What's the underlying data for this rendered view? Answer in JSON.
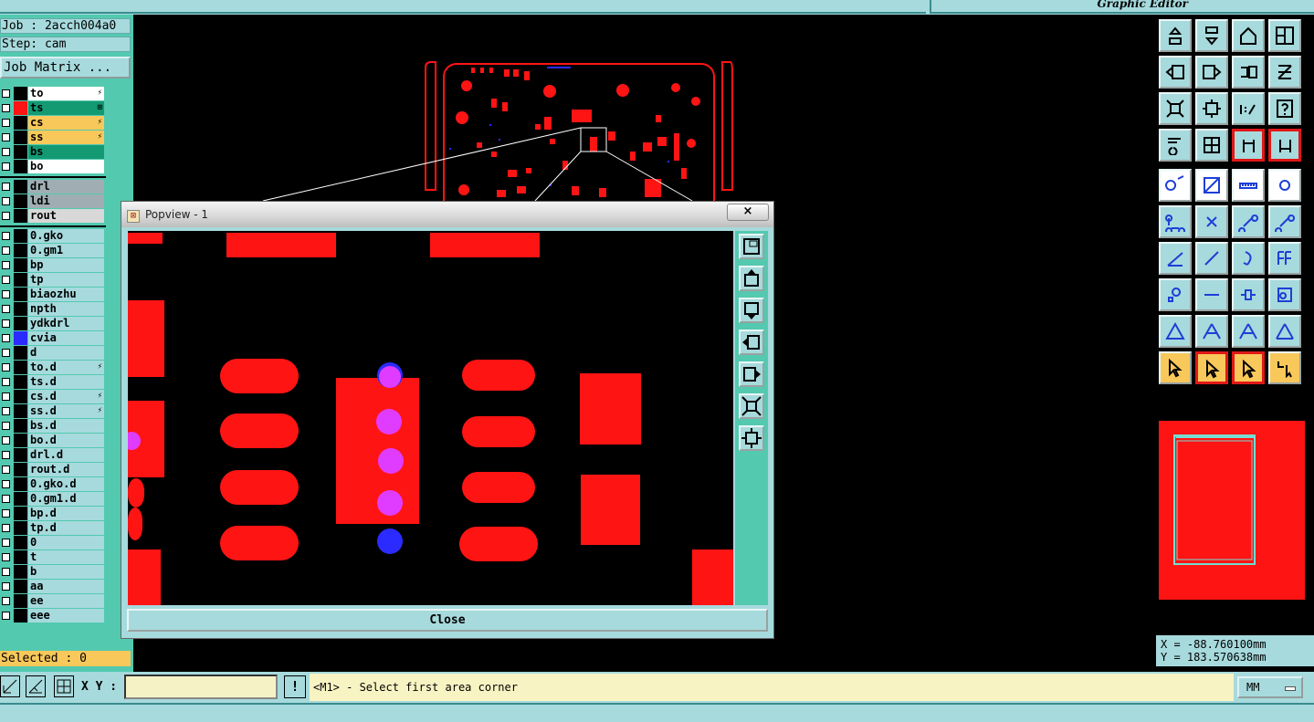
{
  "app_title": "Graphic Editor",
  "left_panel": {
    "job": "Job : 2acch004a0",
    "step": "Step: cam",
    "job_matrix_button": "Job Matrix ...",
    "layers": [
      {
        "name": "to",
        "mark": "⚡",
        "color": "",
        "bg": "#ffffff"
      },
      {
        "name": "ts",
        "mark": "⊞",
        "color": "#ff1414",
        "bg": "#139a73",
        "active": true
      },
      {
        "name": "cs",
        "mark": "⚡",
        "color": "",
        "bg": "#f8c85a"
      },
      {
        "name": "ss",
        "mark": "⚡",
        "color": "",
        "bg": "#f8c85a"
      },
      {
        "name": "bs",
        "mark": "",
        "color": "",
        "bg": "#139a73"
      },
      {
        "name": "bo",
        "mark": "",
        "color": "",
        "bg": "#ffffff"
      },
      {
        "name": "drl",
        "mark": "",
        "color": "",
        "bg": "#a0aeb4"
      },
      {
        "name": "ldi",
        "mark": "",
        "color": "",
        "bg": "#a0aeb4"
      },
      {
        "name": "rout",
        "mark": "",
        "color": "",
        "bg": "#d8d8d8"
      },
      {
        "name": "0.gko",
        "mark": "",
        "color": "",
        "bg": "#a7dadd"
      },
      {
        "name": "0.gm1",
        "mark": "",
        "color": "",
        "bg": "#a7dadd"
      },
      {
        "name": "bp",
        "mark": "",
        "color": "",
        "bg": "#a7dadd"
      },
      {
        "name": "tp",
        "mark": "",
        "color": "",
        "bg": "#a7dadd"
      },
      {
        "name": "biaozhu",
        "mark": "",
        "color": "",
        "bg": "#a7dadd"
      },
      {
        "name": "npth",
        "mark": "",
        "color": "",
        "bg": "#a7dadd"
      },
      {
        "name": "ydkdrl",
        "mark": "",
        "color": "",
        "bg": "#a7dadd"
      },
      {
        "name": "cvia",
        "mark": "",
        "color": "#2b2bff",
        "bg": "#a7dadd"
      },
      {
        "name": "d",
        "mark": "",
        "color": "",
        "bg": "#a7dadd"
      },
      {
        "name": "to.d",
        "mark": "⚡",
        "color": "",
        "bg": "#a7dadd"
      },
      {
        "name": "ts.d",
        "mark": "",
        "color": "",
        "bg": "#a7dadd"
      },
      {
        "name": "cs.d",
        "mark": "⚡",
        "color": "",
        "bg": "#a7dadd"
      },
      {
        "name": "ss.d",
        "mark": "⚡",
        "color": "",
        "bg": "#a7dadd"
      },
      {
        "name": "bs.d",
        "mark": "",
        "color": "",
        "bg": "#a7dadd"
      },
      {
        "name": "bo.d",
        "mark": "",
        "color": "",
        "bg": "#a7dadd"
      },
      {
        "name": "drl.d",
        "mark": "",
        "color": "",
        "bg": "#a7dadd"
      },
      {
        "name": "rout.d",
        "mark": "",
        "color": "",
        "bg": "#a7dadd"
      },
      {
        "name": "0.gko.d",
        "mark": "",
        "color": "",
        "bg": "#a7dadd"
      },
      {
        "name": "0.gm1.d",
        "mark": "",
        "color": "",
        "bg": "#a7dadd"
      },
      {
        "name": "bp.d",
        "mark": "",
        "color": "",
        "bg": "#a7dadd"
      },
      {
        "name": "tp.d",
        "mark": "",
        "color": "",
        "bg": "#a7dadd"
      },
      {
        "name": "0",
        "mark": "",
        "color": "",
        "bg": "#a7dadd"
      },
      {
        "name": "t",
        "mark": "",
        "color": "",
        "bg": "#a7dadd"
      },
      {
        "name": "b",
        "mark": "",
        "color": "",
        "bg": "#a7dadd"
      },
      {
        "name": "aa",
        "mark": "",
        "color": "",
        "bg": "#a7dadd"
      },
      {
        "name": "ee",
        "mark": "",
        "color": "",
        "bg": "#a7dadd"
      },
      {
        "name": "eee",
        "mark": "",
        "color": "",
        "bg": "#a7dadd"
      }
    ],
    "selected": "Selected : 0"
  },
  "popview": {
    "title": "Popview - 1",
    "close_x": "×",
    "close_button": "Close"
  },
  "bottom": {
    "xy_label": "X Y :",
    "xy_value": "",
    "excl": "!",
    "prompt": "<M1> - Select first area corner",
    "unit": "MM"
  },
  "coords": {
    "x": "X = -88.760100mm",
    "y": "Y = 183.570638mm"
  },
  "colors": {
    "panel": "#a7dadd",
    "teal": "#53c9b0",
    "copper": "#ff1414",
    "via": "#2b2bff",
    "drill": "#e03cff",
    "highlight": "#f8c85a"
  }
}
